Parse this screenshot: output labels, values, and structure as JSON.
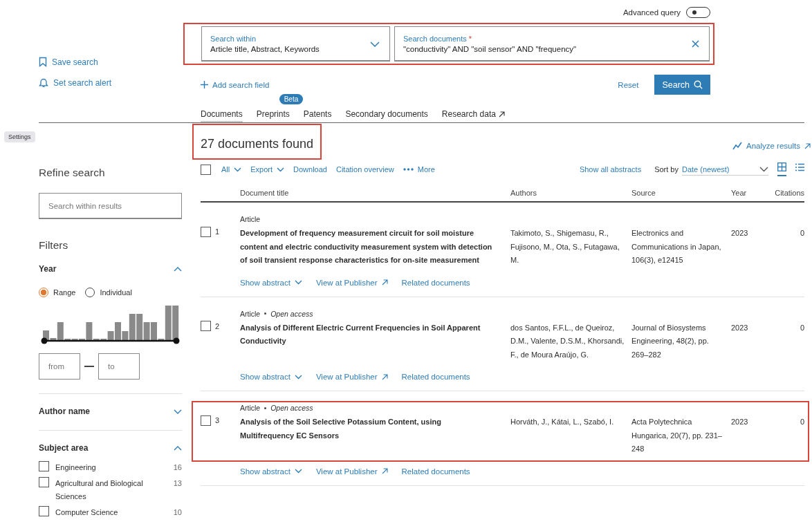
{
  "advanced_query": {
    "label": "Advanced query",
    "on": false
  },
  "search_fields": {
    "highlighted": true,
    "fields": [
      {
        "kind": "select",
        "label": "Search within",
        "value": "Article title, Abstract, Keywords"
      },
      {
        "kind": "text",
        "label": "Search documents",
        "required_mark": "*",
        "value": "\"conductivity\" AND \"soil sensor\" AND \"frequency\""
      }
    ]
  },
  "sidebar_actions": [
    {
      "label": "Save search"
    },
    {
      "label": "Set search alert"
    }
  ],
  "add_search_field": "Add search field",
  "reset": "Reset",
  "search_button": "Search",
  "tabs": [
    {
      "label": "Documents",
      "selected": true
    },
    {
      "label": "Preprints",
      "selected": false,
      "badge": "Beta"
    },
    {
      "label": "Patents",
      "selected": false
    },
    {
      "label": "Secondary documents",
      "selected": false
    },
    {
      "label": "Research data",
      "selected": false,
      "external": true
    }
  ],
  "tooltip": "Settings",
  "results_title": {
    "text": "27 documents found",
    "highlighted": true
  },
  "analyze_results": "Analyze results",
  "refine": {
    "title": "Refine search",
    "search_placeholder": "Search within results",
    "filters_title": "Filters",
    "year": {
      "title": "Year",
      "expanded": true,
      "modes": [
        {
          "label": "Range",
          "selected": true
        },
        {
          "label": "Individual",
          "selected": false
        }
      ],
      "from_placeholder": "from",
      "to_placeholder": "to"
    },
    "author": {
      "title": "Author name",
      "expanded": false
    },
    "subject": {
      "title": "Subject area",
      "expanded": true,
      "items": [
        {
          "label": "Engineering",
          "count": "16",
          "checked": false
        },
        {
          "label": "Agricultural and Biological Sciences",
          "count": "13",
          "checked": false
        },
        {
          "label": "Computer Science",
          "count": "10",
          "checked": false
        }
      ]
    }
  },
  "toolbar": {
    "select_all_checked": false,
    "all": "All",
    "export": "Export",
    "download": "Download",
    "citation_overview": "Citation overview",
    "more": "More",
    "show_all_abstracts": "Show all abstracts",
    "sort_label": "Sort by",
    "sort_value": "Date (newest)",
    "views": [
      {
        "kind": "grid",
        "selected": true
      },
      {
        "kind": "list",
        "selected": false
      }
    ]
  },
  "table": {
    "columns": [
      "Document title",
      "Authors",
      "Source",
      "Year",
      "Citations"
    ],
    "rows": [
      {
        "number": "1",
        "checked": false,
        "highlighted": false,
        "type": "Article",
        "title": "Development of frequency measurement circuit for soil moisture content and electric conductivity measurement system with detection of soil transient response characteristics for on-site measurement",
        "authors": "Takimoto, S., Shigemasu, R., Fujisono, M., Ota, S., Futagawa, M.",
        "source": "Electronics and Communications in Japan, 106(3), e12415",
        "year": "2023",
        "citations": "0",
        "actions": [
          "Show abstract",
          "View at Publisher",
          "Related documents"
        ]
      },
      {
        "number": "2",
        "checked": false,
        "highlighted": false,
        "type": "Article",
        "access": "Open access",
        "title": "Analysis of Different Electric Current Frequencies in Soil Apparent Conductivity",
        "authors": "dos Santos, F.F.L., de Queiroz, D.M., Valente, D.S.M., Khorsandi, F., de Moura Araújo, G.",
        "source": "Journal of Biosystems Engineering, 48(2), pp. 269–282",
        "year": "2023",
        "citations": "0",
        "actions": [
          "Show abstract",
          "View at Publisher",
          "Related documents"
        ]
      },
      {
        "number": "3",
        "checked": false,
        "highlighted": true,
        "type": "Article",
        "access": "Open access",
        "title": "Analysis of the Soil Selective Potassium Content, using Multifrequency EC Sensors",
        "authors": "Horváth, J., Kátai, L., Szabó, I.",
        "source": "Acta Polytechnica Hungarica, 20(7), pp. 231–248",
        "year": "2023",
        "citations": "0",
        "actions": [
          "Show abstract",
          "View at Publisher",
          "Related documents"
        ]
      }
    ]
  }
}
